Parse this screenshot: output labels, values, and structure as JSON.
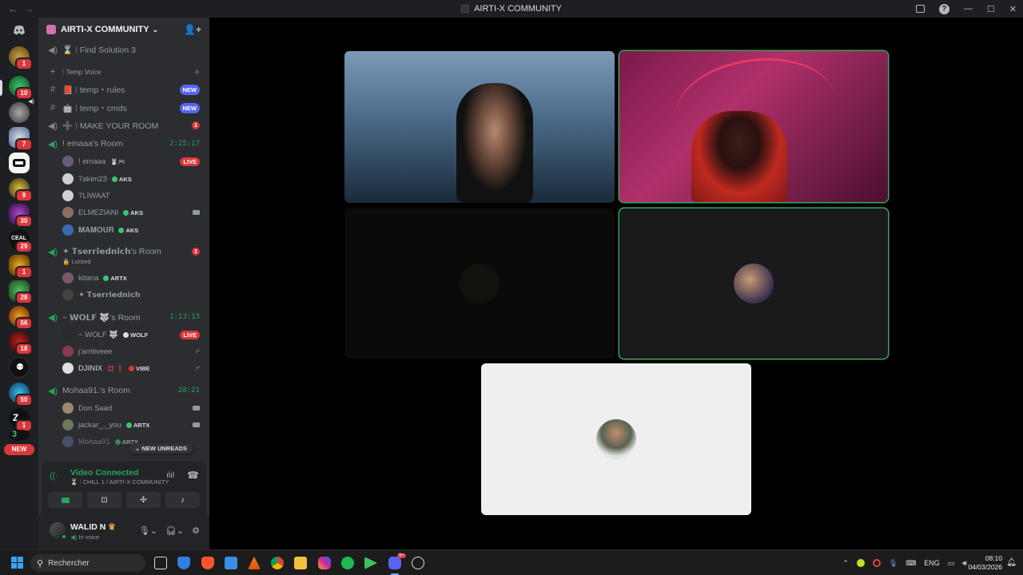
{
  "window": {
    "title": "AIRTI-X COMMUNITY",
    "nav_back": "←",
    "nav_forward": "→",
    "minimize": "—",
    "maximize": "☐",
    "close": "✕",
    "help": "?"
  },
  "server_list": {
    "badges": [
      "1",
      "10",
      "7",
      "9",
      "30",
      "29",
      "1",
      "28",
      "56",
      "18",
      "50",
      "1"
    ],
    "new_label": "NEW"
  },
  "server": {
    "name": "AIRTI-X COMMUNITY"
  },
  "channels": [
    {
      "icon": "voice-icon",
      "name": "⌛ ⁞ Find Solution 3"
    },
    {
      "icon": "plus-icon",
      "name": "⁞ Temp Voice"
    },
    {
      "icon": "hash-icon",
      "name": "📕 ⁞ temp・rules",
      "badge": "NEW"
    },
    {
      "icon": "hash-icon",
      "name": "🤖 ⁞ temp・cmds",
      "badge": "NEW"
    },
    {
      "icon": "voice-icon",
      "name": "➕ ⁞ MAKE YOUR ROOM",
      "count": "1"
    },
    {
      "icon": "voice-active-icon",
      "name": "! emaaa's Room",
      "timer": "2:25:17"
    },
    {
      "icon": "voice-active-icon",
      "name": "✦ 𝗧𝘀𝗲𝗿𝗿𝗶𝗲𝗱𝗻𝗶𝗰𝗵's Room",
      "count": "1"
    },
    {
      "icon": "voice-active-icon",
      "name": "~ 𝗪𝗢𝗟𝗙 🐺's Room",
      "timer": "1:13:13"
    },
    {
      "icon": "voice-active-icon",
      "name": "Mohaa91.'s Room",
      "timer": "28:21"
    }
  ],
  "locked_label": "🔒 Locked",
  "members": [
    {
      "name": "! emaaa",
      "extra": "🐰🎮",
      "tag": "",
      "state": "LIVE"
    },
    {
      "name": "7akim23",
      "tag": "AKS",
      "state": ""
    },
    {
      "name": "7LIWAAT",
      "tag": "",
      "state": ""
    },
    {
      "name": "ELMEZIANI",
      "tag": "AKS",
      "state": "camera"
    },
    {
      "name": "𝐌𝐀𝐌𝐎𝐔𝐑",
      "tag": "AKS",
      "state": ""
    },
    {
      "name": "kitana",
      "tag": "ARTX",
      "state": ""
    },
    {
      "name": "✦ 𝗧𝘀𝗲𝗿𝗿𝗶𝗲𝗱𝗻𝗶𝗰𝗵",
      "tag": "",
      "state": ""
    },
    {
      "name": "~ WOLF 🐺",
      "tag": "WOLF",
      "state": "LIVE"
    },
    {
      "name": "j'arriiiveee",
      "tag": "",
      "state": "muted"
    },
    {
      "name": "DJINIX",
      "extra": "💢 ❗",
      "tag": "VIBE",
      "state": "muted"
    },
    {
      "name": "Don Saad",
      "tag": "",
      "state": "camera"
    },
    {
      "name": "jackar_._you",
      "tag": "ARTX",
      "state": "camera"
    },
    {
      "name": "Mohaa91",
      "tag": "ARTX",
      "state": ""
    }
  ],
  "new_unreads": "NEW UNREADS",
  "voice": {
    "status": "Video Connected",
    "channel": "CHILL 1 / AIRTI-X COMMUNITY"
  },
  "user": {
    "name": "WALID N",
    "status": "In voice"
  },
  "taskbar": {
    "search_placeholder": "Rechercher",
    "lang": "ENG",
    "time": "08:10",
    "date": "04/03/2026",
    "discord_badge": "9+"
  },
  "colors": {
    "accent_green": "#23a55a",
    "badge_red": "#da373c",
    "blurple": "#5865f2"
  }
}
